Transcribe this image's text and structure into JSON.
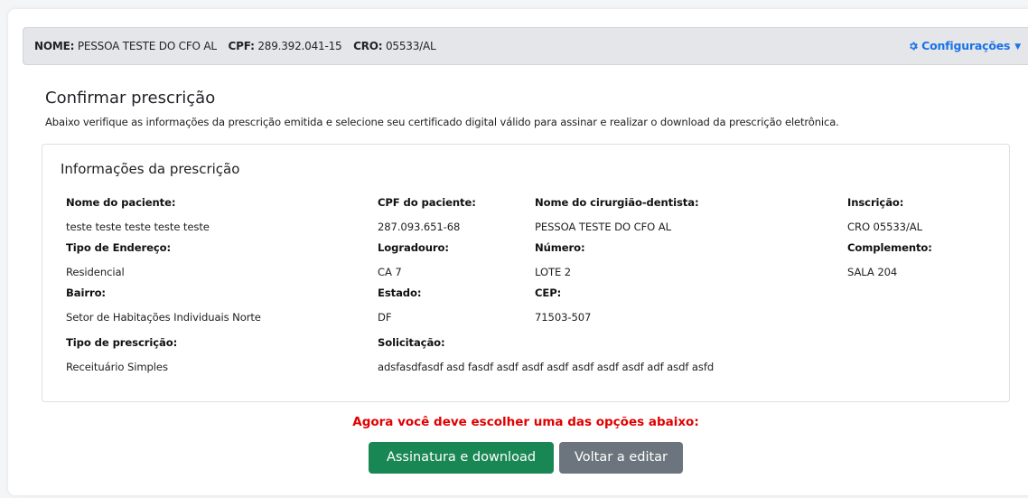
{
  "header": {
    "nome_label": "NOME:",
    "nome_value": "PESSOA TESTE DO CFO AL",
    "cpf_label": "CPF:",
    "cpf_value": "289.392.041-15",
    "cro_label": "CRO:",
    "cro_value": "05533/AL",
    "config_label": "Configurações",
    "config_icon": "gear-icon",
    "accent_color": "#1a73e8"
  },
  "page": {
    "title": "Confirmar prescrição",
    "description": "Abaixo verifique as informações da prescrição emitida e selecione seu certificado digital válido para assinar e realizar o download da prescrição eletrônica."
  },
  "info": {
    "section_title": "Informações da prescrição",
    "fields": [
      {
        "label": "Nome do paciente:",
        "value": "teste teste teste teste teste"
      },
      {
        "label": "CPF do paciente:",
        "value": "287.093.651-68"
      },
      {
        "label": "Nome do cirurgião-dentista:",
        "value": "PESSOA TESTE DO CFO AL"
      },
      {
        "label": "Inscrição:",
        "value": "CRO 05533/AL"
      },
      {
        "label": "Tipo de Endereço:",
        "value": "Residencial"
      },
      {
        "label": "Logradouro:",
        "value": "CA 7"
      },
      {
        "label": "Número:",
        "value": "LOTE 2"
      },
      {
        "label": "Complemento:",
        "value": "SALA 204"
      },
      {
        "label": "Bairro:",
        "value": "Setor de Habitações Individuais Norte"
      },
      {
        "label": "Estado:",
        "value": "DF"
      },
      {
        "label": "CEP:",
        "value": "71503-507"
      },
      {
        "label": "Tipo de prescrição:",
        "value": "Receituário Simples"
      },
      {
        "label": "Solicitação:",
        "value": "adsfasdfasdf asd fasdf asdf asdf asdf asdf asdf asdf adf asdf asfd"
      }
    ]
  },
  "actions": {
    "warning": "Agora você deve escolher uma das opções abaixo:",
    "sign_download": "Assinatura e download",
    "back_edit": "Voltar a editar",
    "warning_color": "#e00000",
    "primary_color": "#198754",
    "secondary_color": "#6c757d"
  }
}
